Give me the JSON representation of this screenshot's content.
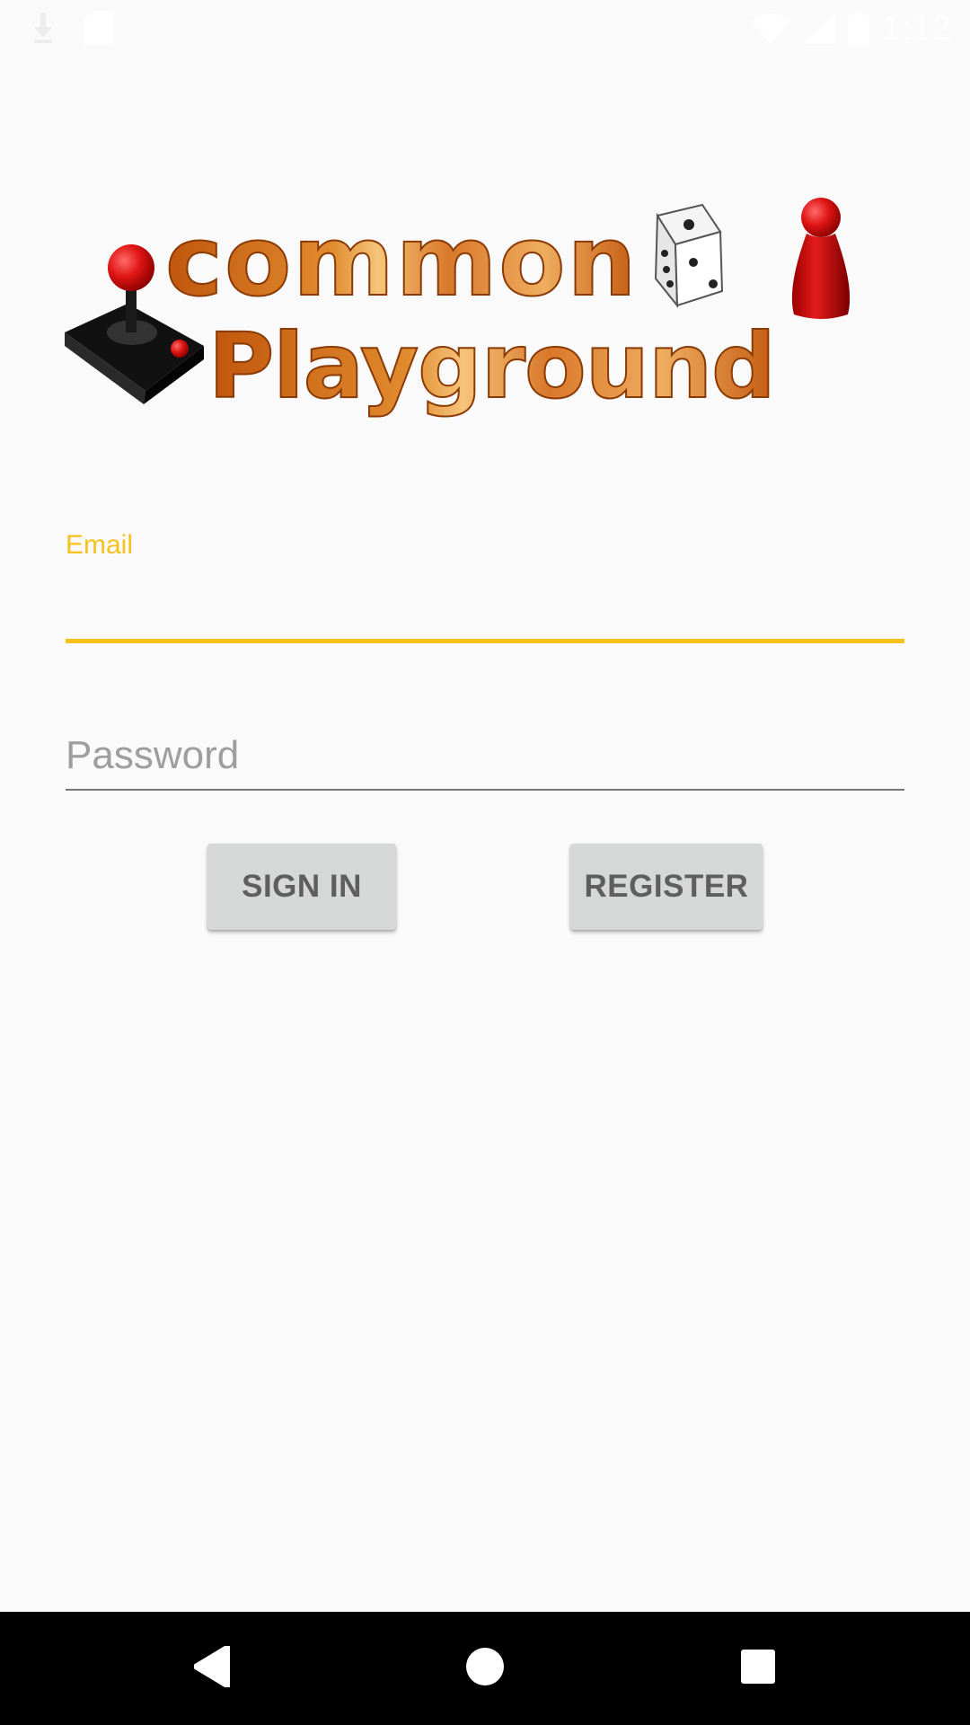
{
  "status_bar": {
    "time": "1:12",
    "icons": [
      "download-icon",
      "sd-card-icon",
      "wifi-icon",
      "signal-icon",
      "battery-icon"
    ]
  },
  "logo": {
    "text_line1": "common",
    "text_line2": "Playground",
    "alt": "Common Playground logo"
  },
  "form": {
    "email": {
      "label": "Email",
      "value": "",
      "placeholder": ""
    },
    "password": {
      "value": "",
      "placeholder": "Password"
    }
  },
  "buttons": {
    "sign_in": "SIGN IN",
    "register": "REGISTER"
  },
  "colors": {
    "accent": "#f5c11a",
    "background": "#fafafa",
    "button_bg": "#d6d7d7",
    "button_text": "#5e5e5e",
    "nav_bar": "#000000"
  },
  "nav_bar": {
    "icons": [
      "back-icon",
      "home-icon",
      "recents-icon"
    ]
  }
}
